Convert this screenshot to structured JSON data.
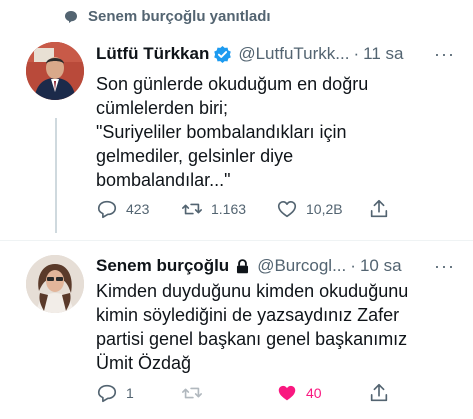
{
  "reply_context": {
    "text": "Senem burçoğlu yanıtladı"
  },
  "tweet1": {
    "name": "Lütfü Türkkan",
    "handle": "@LutfuTurkk...",
    "separator": "·",
    "time": "11 sa",
    "more": "···",
    "verified": true,
    "text": "Son günlerde okuduğum en doğru\ncümlelerden biri;\n\"Suriyeliler bombalandıkları için\ngelmediler, gelsinler diye\nbombalandılar...\"",
    "replies": "423",
    "retweets": "1.163",
    "likes": "10,2B"
  },
  "tweet2": {
    "name": "Senem burçoğlu",
    "handle": "@Burcogl...",
    "separator": "·",
    "time": "10 sa",
    "more": "···",
    "locked": true,
    "text": "Kimden duyduğunu kimden okuduğunu\nkimin söylediğini de yazsaydınız Zafer\npartisi genel başkanı  genel başkanımız\nÜmit Özdağ",
    "replies": "1",
    "retweets": "",
    "likes": "40",
    "liked": true
  },
  "colors": {
    "secondary": "#536471",
    "verified": "#1d9bf0",
    "like": "#f91880",
    "text": "#0f1419"
  }
}
